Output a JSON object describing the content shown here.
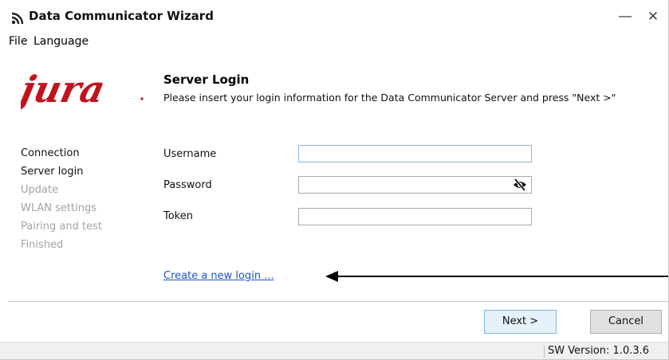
{
  "window": {
    "title": "Data Communicator Wizard",
    "minimize_glyph": "—",
    "close_glyph": "✕",
    "icon": "wireless-signal-icon"
  },
  "menu": {
    "file": "File",
    "language": "Language"
  },
  "logo": {
    "text": "jura",
    "color": "#c0141c"
  },
  "header": {
    "title": "Server Login",
    "description": "Please insert your login information for the Data Communicator Server and press \"Next >\""
  },
  "steps": [
    {
      "label": "Connection",
      "state": "active"
    },
    {
      "label": "Server login",
      "state": "active"
    },
    {
      "label": "Update",
      "state": "inactive"
    },
    {
      "label": "WLAN settings",
      "state": "inactive"
    },
    {
      "label": "Pairing and test",
      "state": "inactive"
    },
    {
      "label": "Finished",
      "state": "inactive"
    }
  ],
  "form": {
    "username_label": "Username",
    "username_value": "",
    "password_label": "Password",
    "password_value": "",
    "password_toggle_icon": "eye-slash-icon",
    "token_label": "Token",
    "token_value": ""
  },
  "link": {
    "create_login": "Create a new login ..."
  },
  "buttons": {
    "next": "Next >",
    "cancel": "Cancel"
  },
  "status": {
    "version": "SW Version:  1.0.3.6"
  },
  "colors": {
    "accent_button": "#e5f1fb",
    "accent_border": "#7eb4ea",
    "link": "#1a55c4",
    "inactive_step": "#a3a3a3"
  }
}
